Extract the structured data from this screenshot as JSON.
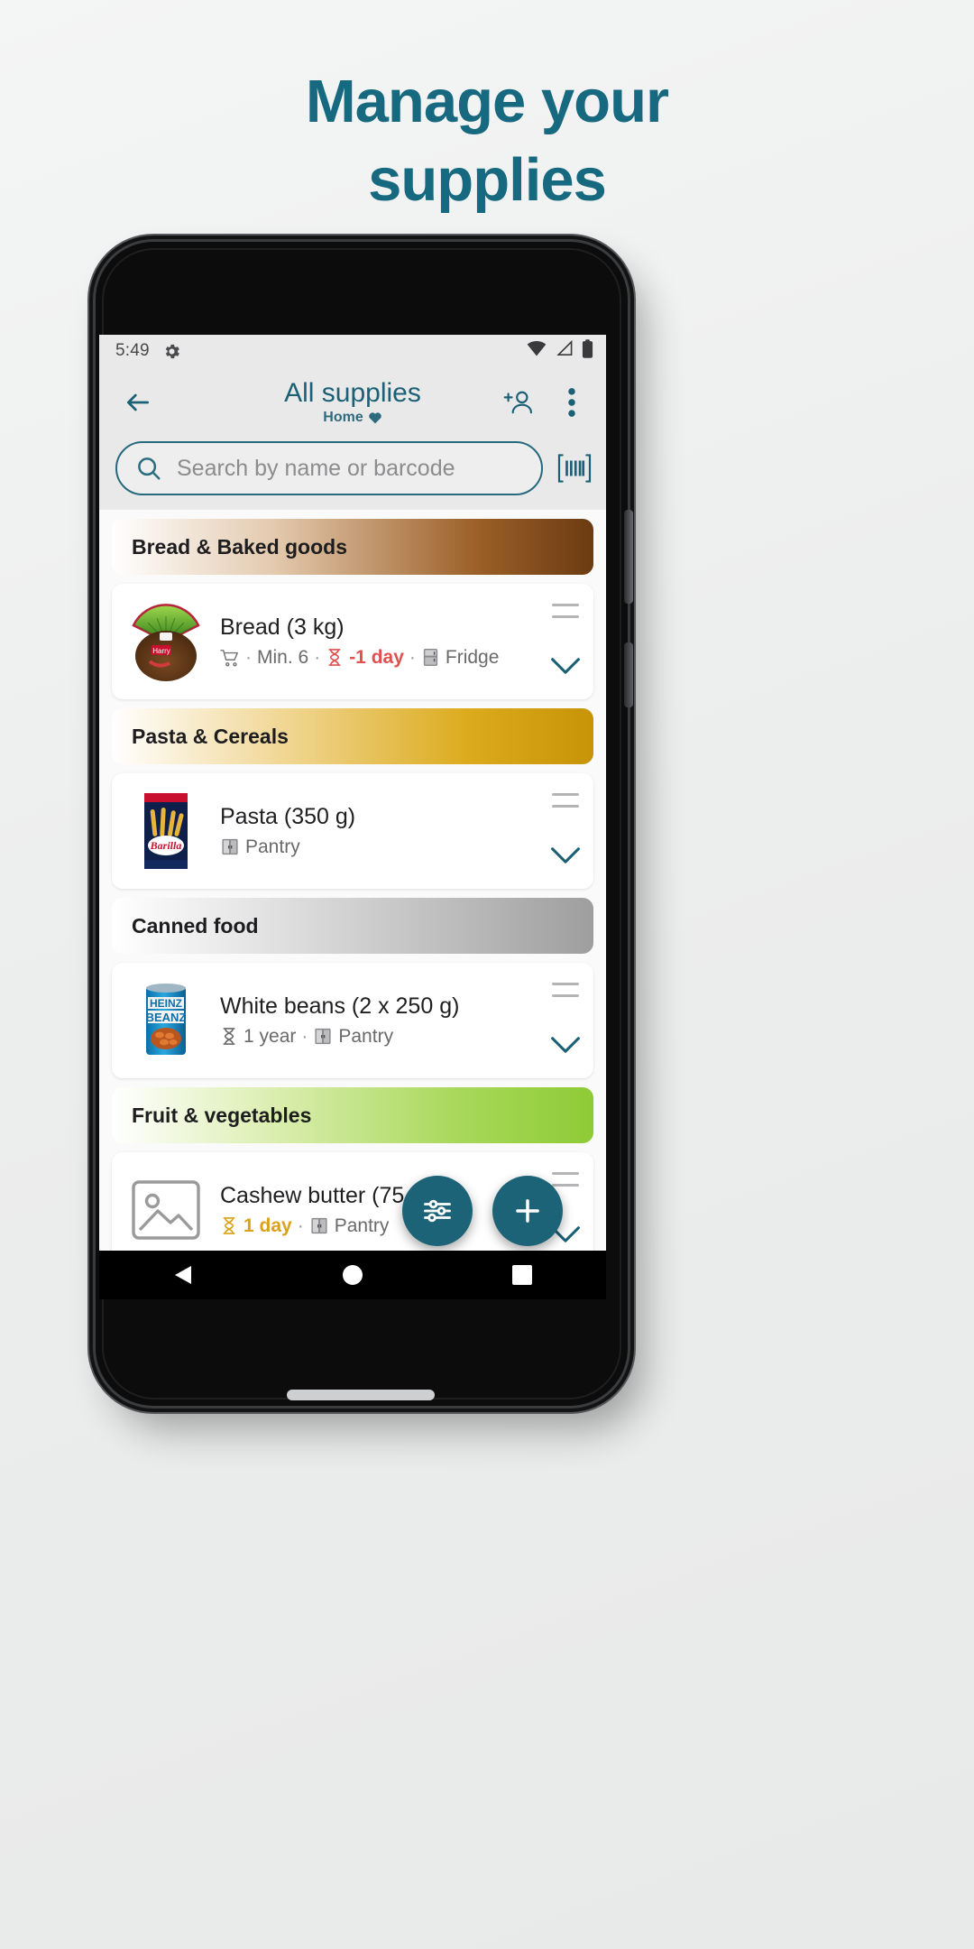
{
  "promo": {
    "line1": "Manage your",
    "line2": "supplies",
    "color": "#16697f"
  },
  "status_bar": {
    "time": "5:49",
    "icons": [
      "gear-icon",
      "wifi-icon",
      "signal-icon",
      "battery-icon"
    ]
  },
  "app_bar": {
    "back_icon": "arrow-left-icon",
    "title": "All supplies",
    "subtitle": "Home",
    "subtitle_icon": "heart-icon",
    "actions": [
      {
        "name": "add-person-icon",
        "label": "Add person"
      },
      {
        "name": "overflow-menu-icon",
        "label": "More options"
      }
    ],
    "title_color": "#1c6076"
  },
  "search": {
    "placeholder": "Search by name or barcode",
    "value": "",
    "search_icon": "search-icon",
    "barcode_icon": "barcode-icon",
    "border_color": "#27697d"
  },
  "sections": [
    {
      "category": "Bread & Baked goods",
      "style": "cat-bread",
      "items": [
        {
          "name": "Bread (3 kg)",
          "thumb": "bread-photo",
          "meta": [
            {
              "type": "icon",
              "name": "shopping-cart-icon"
            },
            {
              "type": "text",
              "text": "Min. 6"
            },
            {
              "type": "icon",
              "name": "hourglass-icon",
              "color": "#e1504f"
            },
            {
              "type": "text",
              "text": "-1 day",
              "style": "due-red"
            },
            {
              "type": "icon",
              "name": "fridge-icon"
            },
            {
              "type": "text",
              "text": "Fridge"
            }
          ]
        }
      ]
    },
    {
      "category": "Pasta & Cereals",
      "style": "cat-pasta",
      "items": [
        {
          "name": "Pasta (350 g)",
          "thumb": "pasta-photo",
          "meta": [
            {
              "type": "icon",
              "name": "pantry-icon"
            },
            {
              "type": "text",
              "text": "Pantry"
            }
          ]
        }
      ]
    },
    {
      "category": "Canned food",
      "style": "cat-canned",
      "items": [
        {
          "name": "White beans (2 x 250 g)",
          "thumb": "beans-photo",
          "meta": [
            {
              "type": "icon",
              "name": "hourglass-icon"
            },
            {
              "type": "text",
              "text": "1 year"
            },
            {
              "type": "icon",
              "name": "pantry-icon"
            },
            {
              "type": "text",
              "text": "Pantry"
            }
          ]
        }
      ]
    },
    {
      "category": "Fruit & vegetables",
      "style": "cat-fruit",
      "items": [
        {
          "name": "Cashew butter (75 g)",
          "thumb": "image-placeholder-icon",
          "meta": [
            {
              "type": "icon",
              "name": "hourglass-icon",
              "color": "#d8a21a"
            },
            {
              "type": "text",
              "text": "1 day",
              "style": "due-amber"
            },
            {
              "type": "icon",
              "name": "pantry-icon"
            },
            {
              "type": "text",
              "text": "Pantry"
            }
          ]
        }
      ]
    }
  ],
  "fabs": [
    {
      "name": "filter-fab",
      "icon": "sliders-icon",
      "color": "#1d6378"
    },
    {
      "name": "add-fab",
      "icon": "plus-icon",
      "color": "#1d6378"
    }
  ],
  "nav_bar": {
    "back": "triangle-back-icon",
    "home": "circle-home-icon",
    "recents": "square-recents-icon"
  },
  "row_controls": {
    "drag_handle": "drag-handle-icon",
    "expand": "chevron-down-icon"
  }
}
